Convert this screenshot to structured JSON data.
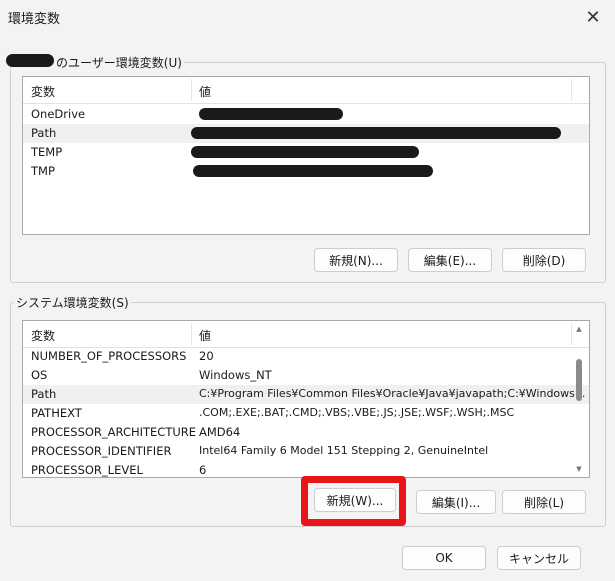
{
  "window": {
    "title": "環境変数",
    "close_glyph": "✕"
  },
  "user_vars": {
    "group_label": "のユーザー環境変数(U)",
    "columns": [
      "変数",
      "値"
    ],
    "rows": [
      {
        "name": "OneDrive",
        "value": ""
      },
      {
        "name": "Path",
        "value": ""
      },
      {
        "name": "TEMP",
        "value": ""
      },
      {
        "name": "TMP",
        "value": ""
      }
    ],
    "buttons": {
      "new": "新規(N)...",
      "edit": "編集(E)...",
      "delete": "削除(D)"
    }
  },
  "system_vars": {
    "group_label": "システム環境変数(S)",
    "columns": [
      "変数",
      "値"
    ],
    "rows": [
      {
        "name": "NUMBER_OF_PROCESSORS",
        "value": "20"
      },
      {
        "name": "OS",
        "value": "Windows_NT"
      },
      {
        "name": "Path",
        "value": "C:¥Program Files¥Common Files¥Oracle¥Java¥javapath;C:¥Windows..."
      },
      {
        "name": "PATHEXT",
        "value": ".COM;.EXE;.BAT;.CMD;.VBS;.VBE;.JS;.JSE;.WSF;.WSH;.MSC"
      },
      {
        "name": "PROCESSOR_ARCHITECTURE",
        "value": "AMD64"
      },
      {
        "name": "PROCESSOR_IDENTIFIER",
        "value": "Intel64 Family 6 Model 151 Stepping 2, GenuineIntel"
      },
      {
        "name": "PROCESSOR_LEVEL",
        "value": "6"
      }
    ],
    "buttons": {
      "new": "新規(W)...",
      "edit": "編集(I)...",
      "delete": "削除(L)"
    }
  },
  "footer": {
    "ok": "OK",
    "cancel": "キャンセル"
  },
  "colors": {
    "highlight": "#e8141a",
    "redaction": "#1a1a1a"
  }
}
